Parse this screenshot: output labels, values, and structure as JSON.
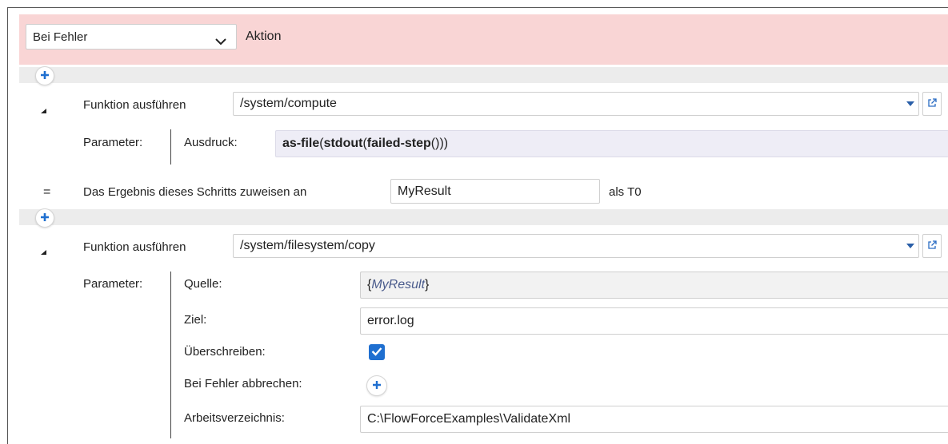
{
  "header": {
    "select_value": "Bei Fehler",
    "action_label": "Aktion"
  },
  "step1": {
    "label": "Funktion ausführen",
    "function_path": "/system/compute",
    "params_label": "Parameter:",
    "expression_label": "Ausdruck:",
    "expression_parts": [
      "as-file",
      "(",
      "stdout",
      "(",
      "failed-step",
      "()))"
    ]
  },
  "assign": {
    "symbol": "=",
    "label": "Das Ergebnis dieses Schritts zuweisen an",
    "value": "MyResult",
    "suffix": "als T0"
  },
  "step2": {
    "label": "Funktion ausführen",
    "function_path": "/system/filesystem/copy",
    "params_label": "Parameter:",
    "source_label": "Quelle:",
    "source_value_open": "{",
    "source_value_var": "MyResult",
    "source_value_close": "}",
    "target_label": "Ziel:",
    "target_value": "error.log",
    "overwrite_label": "Überschreiben:",
    "overwrite_checked": true,
    "abort_label": "Bei Fehler abbrechen:",
    "workdir_label": "Arbeitsverzeichnis:",
    "workdir_value": "C:\\FlowForceExamples\\ValidateXml"
  },
  "colors": {
    "header_bg": "#f9d5d5",
    "accent": "#1f6fd0",
    "expression_bg": "#eeedf6"
  }
}
